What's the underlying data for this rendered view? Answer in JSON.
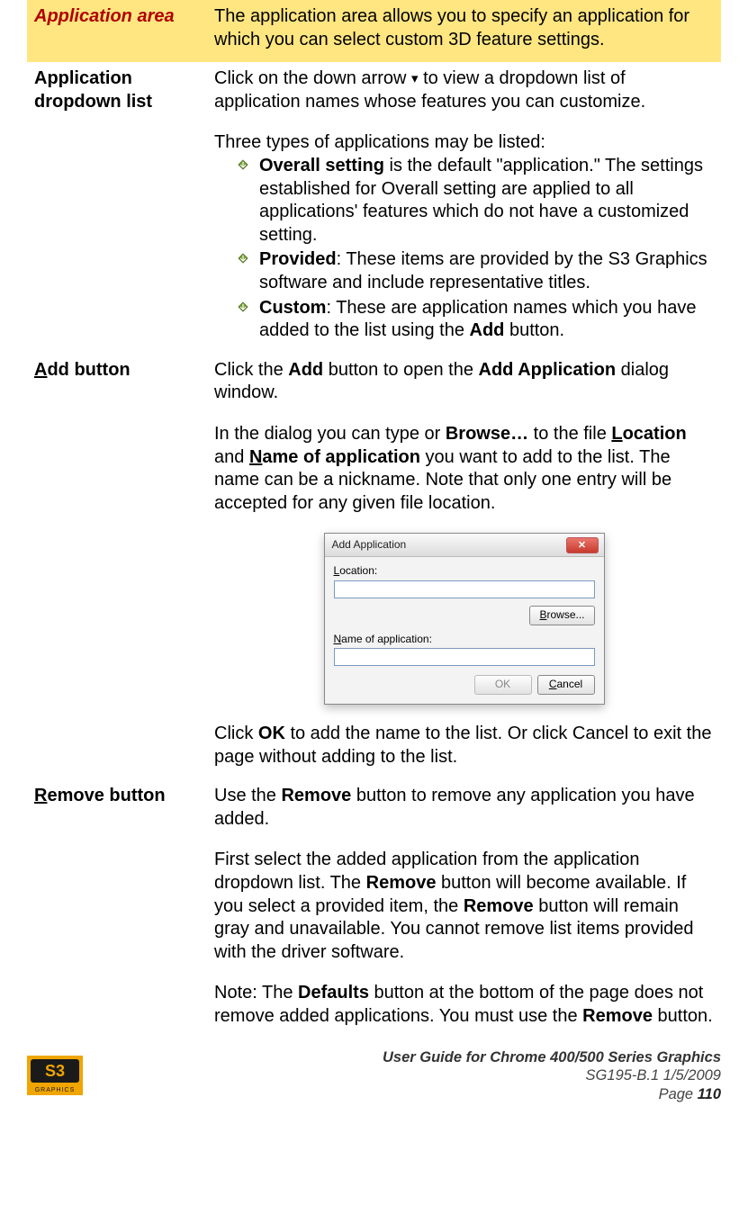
{
  "rows": {
    "app_area": {
      "term": "Application area",
      "desc": "The application area allows you to specify an application for which you can select custom 3D feature settings."
    },
    "dropdown": {
      "term": "Application dropdown list",
      "intro_a": "Click on the down arrow ",
      "intro_b": " to view a dropdown list of application names whose features you can customize.",
      "types_intro": "Three types of applications may be listed:",
      "items": [
        {
          "lead": "Overall setting",
          "rest": " is the default \"application.\" The settings established for Overall setting are applied to all applications' features which do not have a customized setting."
        },
        {
          "lead": "Provided",
          "rest": ": These items are provided by the S3 Graphics software and include representative titles."
        },
        {
          "lead": "Custom",
          "rest": ": These are application names which you have added to the list using the ",
          "tail_bold": "Add",
          "tail_rest": " button."
        }
      ]
    },
    "add": {
      "term_u": "A",
      "term_rest": "dd button",
      "p1_a": "Click the ",
      "p1_b": "Add",
      "p1_c": " button to open the ",
      "p1_d": "Add Application",
      "p1_e": " dialog window.",
      "p2_a": "In the dialog you can type or ",
      "p2_b": "Browse…",
      "p2_c": " to the file ",
      "p2_d_u": "L",
      "p2_d_rest": "ocation",
      "p2_e": " and ",
      "p2_f_u": "N",
      "p2_f_rest": "ame of application",
      "p2_g": " you want to add to the list. The name can be a nickname. Note that only one entry will be accepted for any given file location.",
      "p3_a": "Click ",
      "p3_b": "OK",
      "p3_c": " to add the name to the list. Or click Cancel to exit the page without adding to the list."
    },
    "remove": {
      "term_u": "R",
      "term_rest": "emove button",
      "p1_a": "Use the ",
      "p1_b": "Remove",
      "p1_c": " button to remove any application you have added.",
      "p2_a": "First select the added application from the application dropdown list. The ",
      "p2_b": "Remove",
      "p2_c": " button will become available. If you select a provided item, the ",
      "p2_d": "Remove",
      "p2_e": " button will remain gray and unavailable. You cannot remove list items provided with the driver software.",
      "p3_a": "Note: The ",
      "p3_b": "Defaults",
      "p3_c": " button at the bottom of the page does not remove added applications. You must use the ",
      "p3_d": "Remove",
      "p3_e": " button."
    }
  },
  "dialog": {
    "title": "Add Application",
    "location_label_u": "L",
    "location_label_rest": "ocation:",
    "name_label_u": "N",
    "name_label_rest": "ame of application:",
    "browse_u": "B",
    "browse_rest": "rowse...",
    "ok": "OK",
    "cancel_u": "C",
    "cancel_rest": "ancel",
    "close_glyph": "✕"
  },
  "footer": {
    "line1": "User Guide for Chrome 400/500 Series Graphics",
    "line2": "SG195-B.1   1/5/2009",
    "page_word": "Page ",
    "page_num": "110"
  },
  "glyphs": {
    "dropdown": "▾"
  }
}
